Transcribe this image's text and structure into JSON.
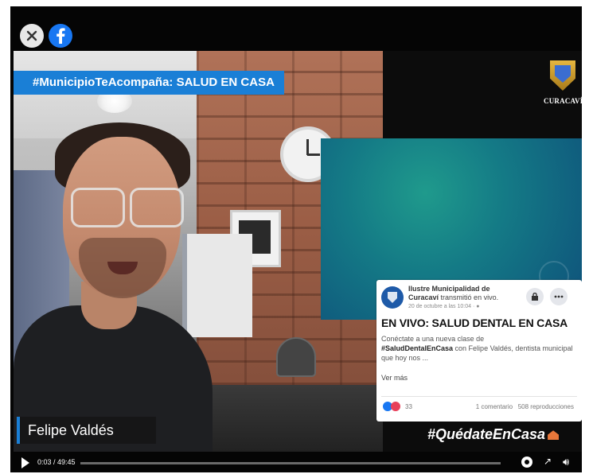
{
  "header": {
    "banner_hashtag": "#MunicipioTeAcompaña: SALUD EN CASA"
  },
  "logo": {
    "text": "CURACAVÍ"
  },
  "video": {
    "speaker_name": "Felipe Valdés",
    "overlay_hashtag": "#QuédateEnCasa",
    "accent_color": "#1a7fd6",
    "progress_fraction": 0.0
  },
  "post": {
    "page_name": "Ilustre Municipalidad de",
    "page_name_cont": "Curacaví",
    "page_status": "transmitió en vivo.",
    "date": "20 de octubre a las 10:04 ·",
    "title": "EN VIVO: SALUD DENTAL EN CASA",
    "body_intro": "Conéctate a una nueva clase de",
    "body_tag": "#SaludDentalEnCasa",
    "body_rest": "con Felipe Valdés, dentista municipal que hoy nos ...",
    "see_more": "Ver más",
    "reaction_count": "33",
    "comments": "1 comentario",
    "views": "508 reproducciones"
  },
  "controls": {
    "timecode": "0:03 / 49:45"
  }
}
